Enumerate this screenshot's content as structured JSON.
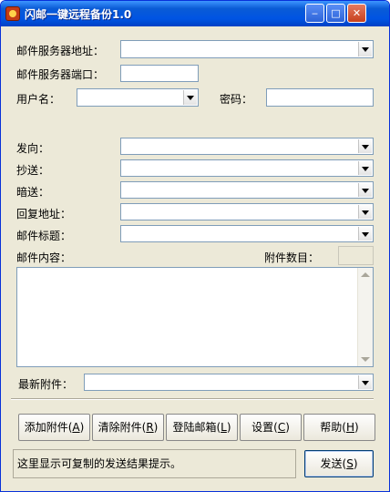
{
  "window": {
    "title": "闪邮一键远程备份1.0",
    "min_label": "‒",
    "max_label": "□",
    "close_label": "✕"
  },
  "form": {
    "server_label": "邮件服务器地址：",
    "server_value": "",
    "port_label": "邮件服务器端口：",
    "port_value": "",
    "user_label": "用户名：",
    "user_value": "",
    "password_label": "密码：",
    "password_value": "",
    "from_label": "发向：",
    "cc_label": "抄送：",
    "bcc_label": "暗送：",
    "reply_label": "回复地址：",
    "subject_label": "邮件标题：",
    "body_label": "邮件内容：",
    "attach_count_label": "附件数目：",
    "latest_attach_label": "最新附件："
  },
  "buttons": {
    "add": {
      "text": "添加附件",
      "key": "A"
    },
    "clear": {
      "text": "清除附件",
      "key": "R"
    },
    "login": {
      "text": "登陆邮箱",
      "key": "L"
    },
    "settings": {
      "text": "设置",
      "key": "C"
    },
    "help": {
      "text": "帮助",
      "key": "H"
    },
    "send": {
      "text": "发送",
      "key": "S"
    }
  },
  "status_text": "这里显示可复制的发送结果提示。",
  "colors": {
    "title_bar": "#0054e3",
    "face": "#ece9d8",
    "field_border": "#7f9db9"
  },
  "icons": [
    "app-icon",
    "minimize-icon",
    "maximize-icon",
    "close-icon",
    "chevron-down-icon"
  ]
}
